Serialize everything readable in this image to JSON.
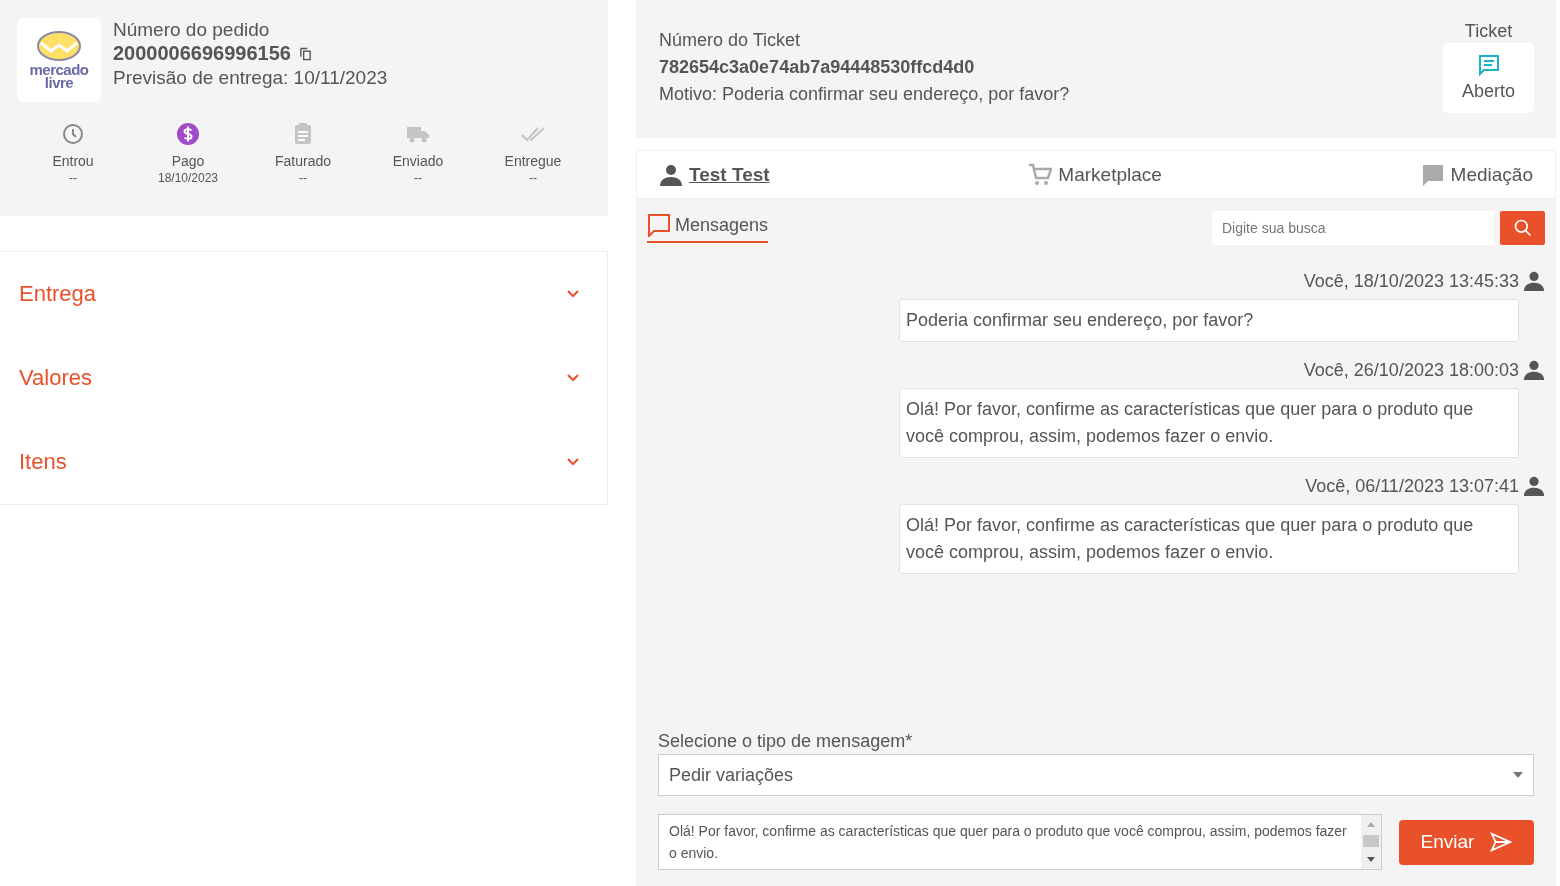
{
  "order": {
    "logo_text": "mercado livre",
    "label": "Número do pedido",
    "number": "2000006696996156",
    "delivery": "Previsão de entrega: 10/11/2023",
    "steps": [
      {
        "kind": "clock",
        "label": "Entrou",
        "date": "--",
        "done": false
      },
      {
        "kind": "payment",
        "label": "Pago",
        "date": "18/10/2023",
        "done": true
      },
      {
        "kind": "invoice",
        "label": "Faturado",
        "date": "--",
        "done": false
      },
      {
        "kind": "truck",
        "label": "Enviado",
        "date": "--",
        "done": false
      },
      {
        "kind": "check",
        "label": "Entregue",
        "date": "--",
        "done": false
      }
    ]
  },
  "sections": [
    {
      "title": "Entrega",
      "expanded": false
    },
    {
      "title": "Valores",
      "expanded": false
    },
    {
      "title": "Itens",
      "expanded": false
    }
  ],
  "ticket": {
    "label": "Número do Ticket",
    "id": "782654c3a0e74ab7a94448530ffcd4d0",
    "reason": "Motivo: Poderia confirmar seu endereço, por favor?",
    "status_label": "Ticket",
    "status": "Aberto"
  },
  "tabs": [
    {
      "kind": "user",
      "label": "Test Test",
      "selected": true
    },
    {
      "kind": "cart",
      "label": "Marketplace",
      "selected": false
    },
    {
      "kind": "chat",
      "label": "Mediação",
      "selected": false
    }
  ],
  "subtab": {
    "label": "Mensagens",
    "selected": true
  },
  "search": {
    "placeholder": "Digite sua busca"
  },
  "messages": [
    {
      "meta": "Você, 18/10/2023 13:45:33",
      "text": "Poderia confirmar seu endereço, por favor?"
    },
    {
      "meta": "Você, 26/10/2023 18:00:03",
      "text": "Olá! Por favor, confirme as características que quer para o produto que você comprou, assim, podemos fazer o envio."
    },
    {
      "meta": "Você, 06/11/2023 13:07:41",
      "text": "Olá! Por favor, confirme as características que quer para o produto que você comprou, assim, podemos fazer o envio."
    }
  ],
  "composer": {
    "type_label": "Selecione o tipo de mensagem*",
    "type_value": "Pedir variações",
    "text": "Olá! Por favor, confirme as características que quer para o produto que você comprou, assim, podemos fazer o envio.",
    "send": "Enviar"
  }
}
